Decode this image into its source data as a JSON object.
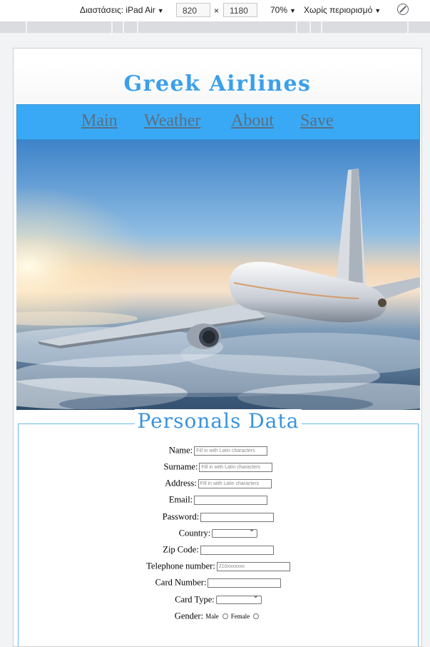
{
  "devtools": {
    "device_label": "Διαστάσεις: iPad Air",
    "width": "820",
    "height": "1180",
    "times": "×",
    "zoom": "70%",
    "throttle": "Χωρίς περιορισμό"
  },
  "site": {
    "title": "Greek Airlines",
    "nav": [
      "Main",
      "Weather",
      "About",
      "Save"
    ],
    "colors": {
      "accent": "#3aa9f5",
      "title": "#3aa0ea",
      "nav_link": "#5b6f80"
    }
  },
  "form": {
    "legend": "Personals Data",
    "fields": {
      "name": {
        "label": "Name:",
        "placeholder": "Fill in with Latin characters"
      },
      "surname": {
        "label": "Surname:",
        "placeholder": "Fill in with Latin characters"
      },
      "address": {
        "label": "Address:",
        "placeholder": "Fill in with Latin characters"
      },
      "email": {
        "label": "Email:",
        "placeholder": ""
      },
      "password": {
        "label": "Password:",
        "placeholder": ""
      },
      "country": {
        "label": "Country:"
      },
      "zip": {
        "label": "Zip Code:",
        "placeholder": ""
      },
      "telephone": {
        "label": "Telephone number:",
        "placeholder": "210xxxxxxx"
      },
      "card_number": {
        "label": "Card Number:",
        "placeholder": ""
      },
      "card_type": {
        "label": "Card Type:"
      },
      "gender": {
        "label": "Gender:",
        "options": [
          "Male",
          "Female"
        ]
      }
    }
  }
}
